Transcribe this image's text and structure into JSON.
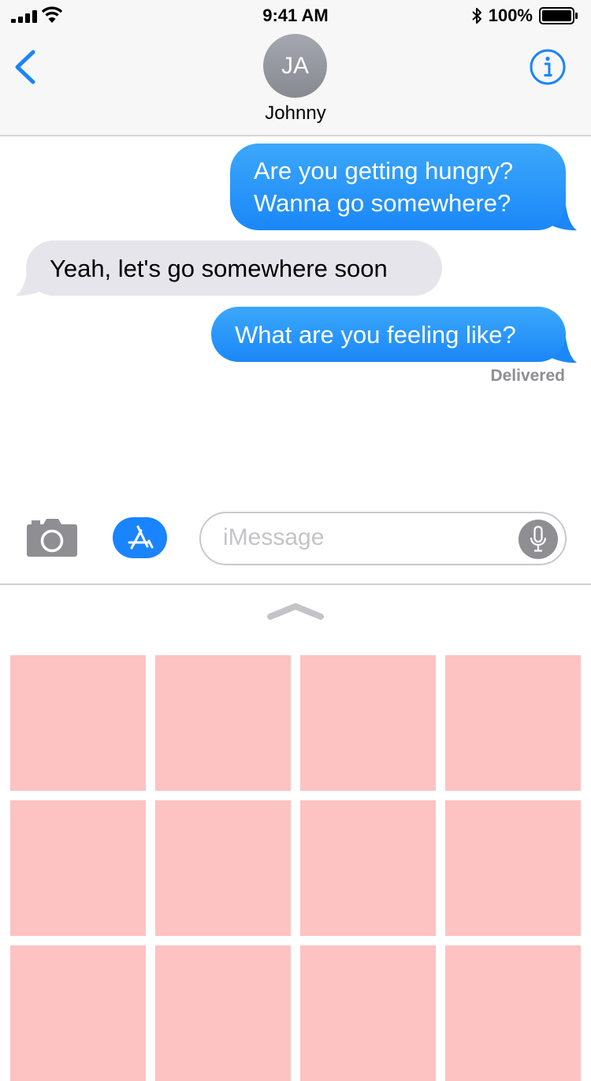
{
  "status_bar": {
    "time": "9:41 AM",
    "battery": "100%",
    "icons": [
      "signal-bars-icon",
      "wifi-icon",
      "bluetooth-icon",
      "battery-icon"
    ]
  },
  "header": {
    "avatar_initials": "JA",
    "contact_name": "Johnny",
    "icons": [
      "chevron-left-icon",
      "info-icon"
    ]
  },
  "messages": [
    {
      "direction": "sent",
      "text": "Are you getting hungry?\nWanna go somewhere?"
    },
    {
      "direction": "received",
      "text": "Yeah, let's go somewhere soon"
    },
    {
      "direction": "sent",
      "text": "What are you feeling like?"
    }
  ],
  "delivery_status": "Delivered",
  "composer": {
    "placeholder": "iMessage",
    "icons": [
      "camera-icon",
      "app-store-icon",
      "microphone-icon"
    ]
  },
  "drawer": {
    "handle_icon": "chevron-up-icon",
    "tile_count": 12
  },
  "colors": {
    "sent_bubble": "#1b87f8",
    "received_bubble": "#e6e5eb",
    "accent": "#1a84ff",
    "tile": "#fdc2c2"
  }
}
